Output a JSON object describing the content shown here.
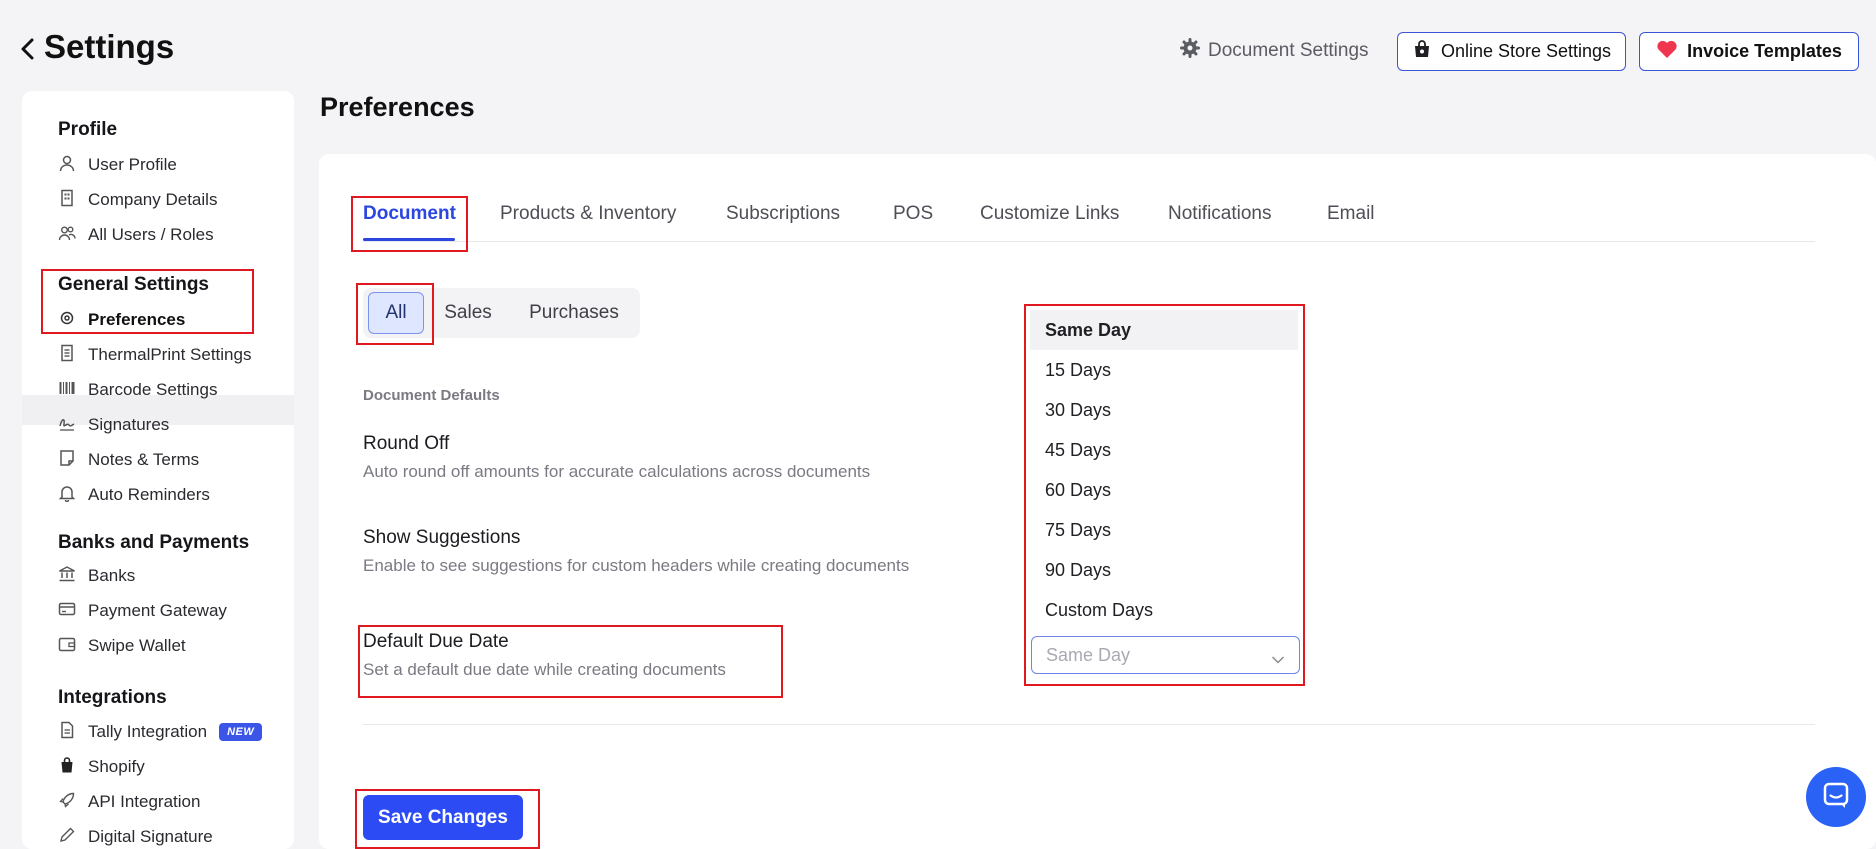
{
  "header": {
    "title": "Settings",
    "document_settings": "Document Settings",
    "online_store_settings": "Online Store Settings",
    "invoice_templates": "Invoice Templates"
  },
  "sidebar": {
    "sections": [
      {
        "title": "Profile",
        "items": [
          "User Profile",
          "Company Details",
          "All Users / Roles"
        ]
      },
      {
        "title": "General Settings",
        "items": [
          "Preferences",
          "ThermalPrint Settings",
          "Barcode Settings",
          "Signatures",
          "Notes & Terms",
          "Auto Reminders"
        ]
      },
      {
        "title": "Banks and Payments",
        "items": [
          "Banks",
          "Payment Gateway",
          "Swipe Wallet"
        ]
      },
      {
        "title": "Integrations",
        "items": [
          "Tally Integration",
          "Shopify",
          "API Integration",
          "Digital Signature"
        ]
      }
    ],
    "active_item": "Preferences",
    "new_badge": "NEW"
  },
  "main": {
    "title": "Preferences",
    "tabs": [
      "Document",
      "Products & Inventory",
      "Subscriptions",
      "POS",
      "Customize Links",
      "Notifications",
      "Email"
    ],
    "active_tab": "Document",
    "filter": [
      "All",
      "Sales",
      "Purchases"
    ],
    "active_filter": "All",
    "section_label": "Document Defaults",
    "rows": [
      {
        "title": "Round Off",
        "desc": "Auto round off amounts for accurate calculations across documents"
      },
      {
        "title": "Show Suggestions",
        "desc": "Enable to see suggestions for custom headers while creating documents"
      },
      {
        "title": "Default Due Date",
        "desc": "Set a default due date while creating documents"
      }
    ],
    "due_date_options": [
      "Same Day",
      "15 Days",
      "30 Days",
      "45 Days",
      "60 Days",
      "75 Days",
      "90 Days",
      "Custom Days"
    ],
    "due_date_value": "Same Day",
    "save_label": "Save Changes"
  },
  "colors": {
    "accent": "#2c4bf5",
    "highlight_box": "#e0181f",
    "invoice_heart": "#f0364f"
  }
}
